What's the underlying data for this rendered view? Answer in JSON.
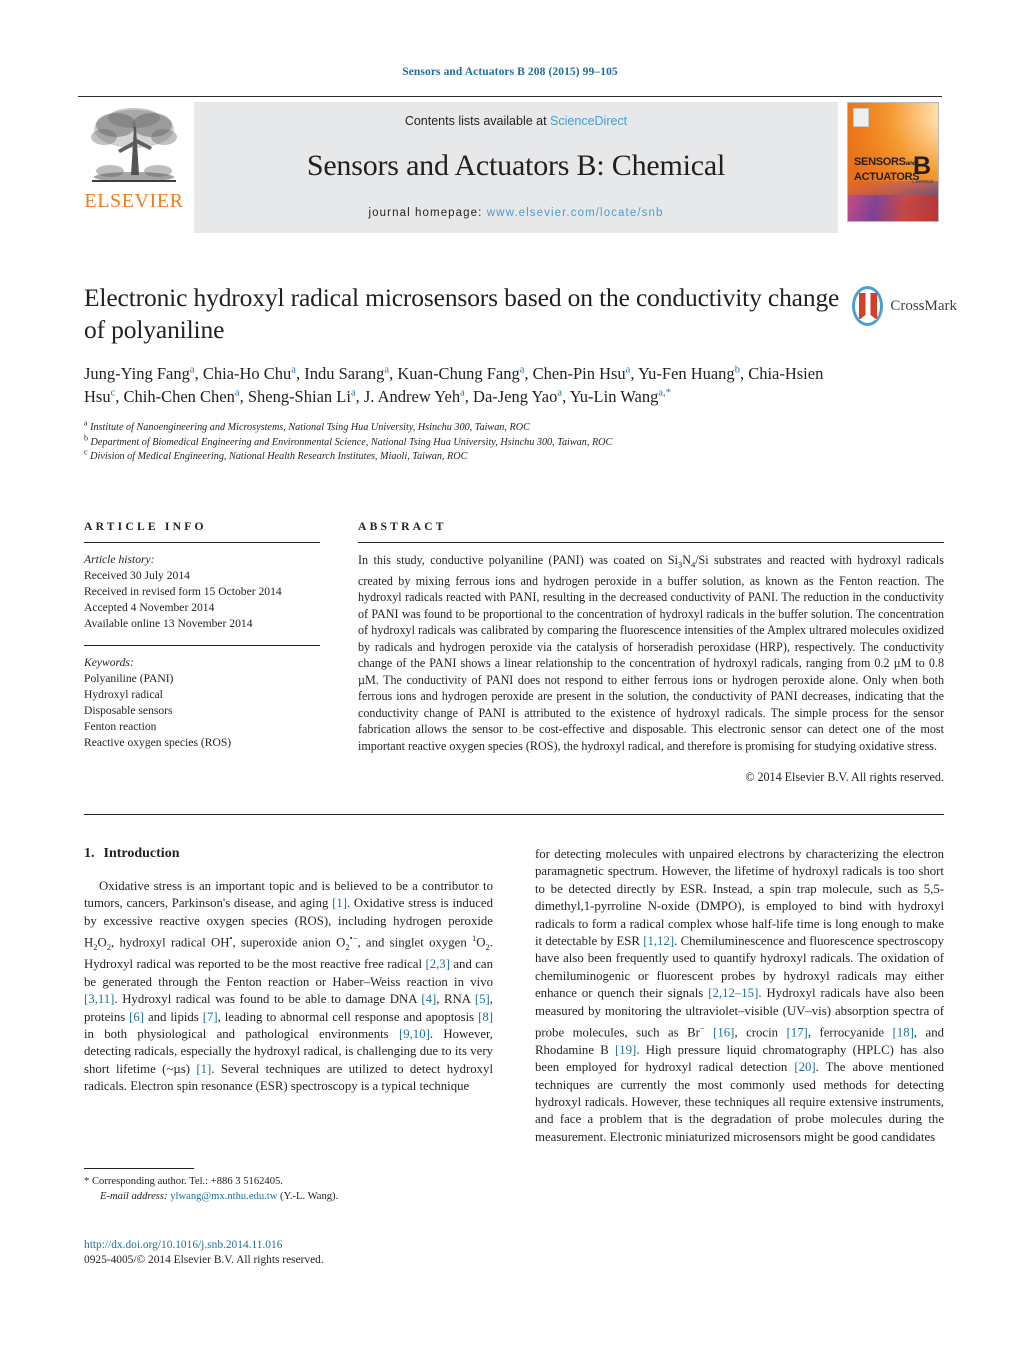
{
  "running_head": "Sensors and Actuators B 208 (2015) 99–105",
  "masthead": {
    "publisher_logo_text": "ELSEVIER",
    "contents_prefix": "Contents lists available at ",
    "contents_link": "ScienceDirect",
    "journal_title": "Sensors and Actuators B: Chemical",
    "homepage_label": "journal homepage: ",
    "homepage_url": "www.elsevier.com/locate/snb",
    "cover": {
      "line1": "SENSORS",
      "and": "and",
      "line2": "ACTUATORS",
      "volume_letter": "B",
      "sub_letter": "Chemical"
    }
  },
  "crossmark": {
    "label": "CrossMark"
  },
  "article": {
    "title": "Electronic hydroxyl radical microsensors based on the conductivity change of polyaniline",
    "authors_html": "Jung-Ying Fang<sup>a</sup>, Chia-Ho Chu<sup>a</sup>, Indu Sarang<sup>a</sup>, Kuan-Chung Fang<sup>a</sup>, Chen-Pin Hsu<sup>a</sup>, Yu-Fen Huang<sup>b</sup>, Chia-Hsien Hsu<sup>c</sup>, Chih-Chen Chen<sup>a</sup>, Sheng-Shian Li<sup>a</sup>, J. Andrew Yeh<sup>a</sup>, Da-Jeng Yao<sup>a</sup>, Yu-Lin Wang<sup>a,*</sup>",
    "affiliations": [
      {
        "marker": "a",
        "text": "Institute of Nanoengineering and Microsystems, National Tsing Hua University, Hsinchu 300, Taiwan, ROC"
      },
      {
        "marker": "b",
        "text": "Department of Biomedical Engineering and Environmental Science, National Tsing Hua University, Hsinchu 300, Taiwan, ROC"
      },
      {
        "marker": "c",
        "text": "Division of Medical Engineering, National Health Research Institutes, Miaoli, Taiwan, ROC"
      }
    ]
  },
  "article_info": {
    "heading": "ARTICLE INFO",
    "history_label": "Article history:",
    "history": [
      "Received 30 July 2014",
      "Received in revised form 15 October 2014",
      "Accepted 4 November 2014",
      "Available online 13 November 2014"
    ],
    "keywords_label": "Keywords:",
    "keywords": [
      "Polyaniline (PANI)",
      "Hydroxyl radical",
      "Disposable sensors",
      "Fenton reaction",
      "Reactive oxygen species (ROS)"
    ]
  },
  "abstract": {
    "heading": "ABSTRACT",
    "body_html": "In this study, conductive polyaniline (PANI) was coated on Si<sub>3</sub>N<sub>4</sub>/Si substrates and reacted with hydroxyl radicals created by mixing ferrous ions and hydrogen peroxide in a buffer solution, as known as the Fenton reaction. The hydroxyl radicals reacted with PANI, resulting in the decreased conductivity of PANI. The reduction in the conductivity of PANI was found to be proportional to the concentration of hydroxyl radicals in the buffer solution. The concentration of hydroxyl radicals was calibrated by comparing the fluorescence intensities of the Amplex ultrared molecules oxidized by radicals and hydrogen peroxide via the catalysis of horseradish peroxidase (HRP), respectively. The conductivity change of the PANI shows a linear relationship to the concentration of hydroxyl radicals, ranging from 0.2 &#181;M to 0.8 &#181;M. The conductivity of PANI does not respond to either ferrous ions or hydrogen peroxide alone. Only when both ferrous ions and hydrogen peroxide are present in the solution, the conductivity of PANI decreases, indicating that the conductivity change of PANI is attributed to the existence of hydroxyl radicals. The simple process for the sensor fabrication allows the sensor to be cost-effective and disposable. This electronic sensor can detect one of the most important reactive oxygen species (ROS), the hydroxyl radical, and therefore is promising for studying oxidative stress.",
    "copyright": "© 2014 Elsevier B.V. All rights reserved."
  },
  "introduction": {
    "number": "1.",
    "heading": "Introduction",
    "left_paragraph_html": "Oxidative stress is an important topic and is believed to be a contributor to tumors, cancers, Parkinson's disease, and aging <span class=\"ref\">[1]</span>. Oxidative stress is induced by excessive reactive oxygen species (ROS), including hydrogen peroxide H<sub>2</sub>O<sub>2</sub>, hydroxyl radical OH<sup class=\"chem\">•</sup>, superoxide anion O<sub>2</sub><sup class=\"chem\">•−</sup>, and singlet oxygen <sup class=\"chem\">1</sup>O<sub>2</sub>. Hydroxyl radical was reported to be the most reactive free radical <span class=\"ref\">[2,3]</span> and can be generated through the Fenton reaction or Haber–Weiss reaction in vivo <span class=\"ref\">[3,11]</span>. Hydroxyl radical was found to be able to damage DNA <span class=\"ref\">[4]</span>, RNA <span class=\"ref\">[5]</span>, proteins <span class=\"ref\">[6]</span> and lipids <span class=\"ref\">[7]</span>, leading to abnormal cell response and apoptosis <span class=\"ref\">[8]</span> in both physiological and pathological environments <span class=\"ref\">[9,10]</span>. However, detecting radicals, especially the hydroxyl radical, is challenging due to its very short lifetime (~&#181;s) <span class=\"ref\">[1]</span>. Several techniques are utilized to detect hydroxyl radicals. Electron spin resonance (ESR) spectroscopy is a typical technique",
    "right_paragraph_html": "for detecting molecules with unpaired electrons by characterizing the electron paramagnetic spectrum. However, the lifetime of hydroxyl radicals is too short to be detected directly by ESR. Instead, a spin trap molecule, such as 5,5-dimethyl,1-pyrroline N-oxide (DMPO), is employed to bind with hydroxyl radicals to form a radical complex whose half-life time is long enough to make it detectable by ESR <span class=\"ref\">[1,12]</span>. Chemiluminescence and fluorescence spectroscopy have also been frequently used to quantify hydroxyl radicals. The oxidation of chemiluminogenic or fluorescent probes by hydroxyl radicals may either enhance or quench their signals <span class=\"ref\">[2,12–15]</span>. Hydroxyl radicals have also been measured by monitoring the ultraviolet–visible (UV–vis) absorption spectra of probe molecules, such as Br<sup class=\"chem\">−</sup> <span class=\"ref\">[16]</span>, crocin <span class=\"ref\">[17]</span>, ferrocyanide <span class=\"ref\">[18]</span>, and Rhodamine B <span class=\"ref\">[19]</span>. High pressure liquid chromatography (HPLC) has also been employed for hydroxyl radical detection <span class=\"ref\">[20]</span>. The above mentioned techniques are currently the most commonly used methods for detecting hydroxyl radicals. However, these techniques all require extensive instruments, and face a problem that is the degradation of probe molecules during the measurement. Electronic miniaturized microsensors might be good candidates"
  },
  "footnote": {
    "star": "*",
    "corresponding": "Corresponding author. Tel.: +886 3 5162405.",
    "email_label": "E-mail address:",
    "email": "ylwang@mx.nthu.edu.tw",
    "email_suffix": "(Y.-L. Wang)."
  },
  "footer": {
    "doi": "http://dx.doi.org/10.1016/j.snb.2014.11.016",
    "issn_line": "0925-4005/© 2014 Elsevier B.V. All rights reserved."
  },
  "colors": {
    "link": "#1f6f9a",
    "sciencedirect": "#4a9ccc",
    "elsevier_orange": "#ef7d22",
    "band_gray": "#e7e8ea",
    "text": "#231f20"
  }
}
